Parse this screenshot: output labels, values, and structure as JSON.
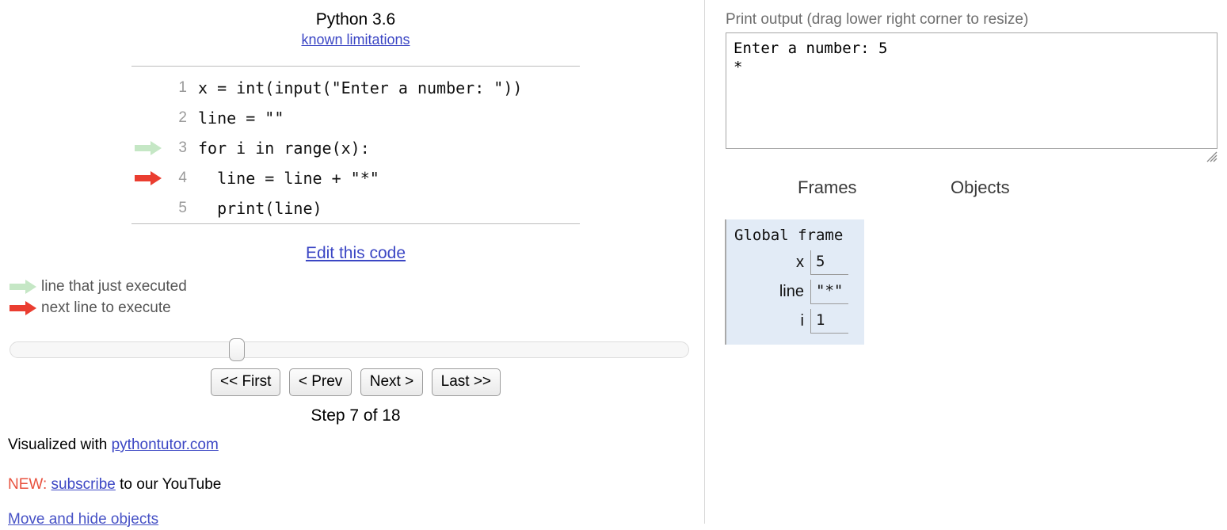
{
  "divider": {
    "name": "panel-divider"
  },
  "left": {
    "language": {
      "name": "Python 3.6",
      "limitations_link": "known limitations"
    },
    "code": {
      "lines": [
        {
          "num": "1",
          "text": "x = int(input(\"Enter a number: \"))",
          "marker": "none"
        },
        {
          "num": "2",
          "text": "line = \"\"",
          "marker": "none"
        },
        {
          "num": "3",
          "text": "for i in range(x):",
          "marker": "green"
        },
        {
          "num": "4",
          "text": "  line = line + \"*\"",
          "marker": "red"
        },
        {
          "num": "5",
          "text": "  print(line)",
          "marker": "none"
        }
      ]
    },
    "edit_code_link": "Edit this code",
    "legend": [
      {
        "marker": "green",
        "label": "line that just executed",
        "icon": "green-arrow-icon"
      },
      {
        "marker": "red",
        "label": "next line to execute",
        "icon": "red-arrow-icon"
      }
    ],
    "slider": {
      "position_percent": 33
    },
    "nav_buttons": [
      {
        "label": "<< First",
        "name": "first-button"
      },
      {
        "label": "< Prev",
        "name": "prev-button"
      },
      {
        "label": "Next >",
        "name": "next-button"
      },
      {
        "label": "Last >>",
        "name": "last-button"
      }
    ],
    "step_label": "Step 7 of 18",
    "step_current": 7,
    "step_total": 18,
    "footer": {
      "visualized_prefix": "Visualized with ",
      "visualized_link": "pythontutor.com",
      "new_tag": "NEW:",
      "subscribe_link": "subscribe",
      "subscribe_suffix": " to our YouTube",
      "cut_off_link": "Move and hide objects"
    }
  },
  "right": {
    "output": {
      "caption": "Print output (drag lower right corner to resize)",
      "text": "Enter a number: 5\n*"
    },
    "headers": {
      "frames": "Frames",
      "objects": "Objects"
    },
    "frame": {
      "title": "Global frame",
      "variables": [
        {
          "name": "x",
          "value": "5"
        },
        {
          "name": "line",
          "value": "\"*\""
        },
        {
          "name": "i",
          "value": "1"
        }
      ]
    }
  },
  "colors": {
    "green_arrow": "#c5e7c5",
    "red_arrow": "#ea3d30",
    "link": "#3b46c4",
    "frame_bg": "#e2ebf6",
    "new_tag": "#e8523f"
  }
}
